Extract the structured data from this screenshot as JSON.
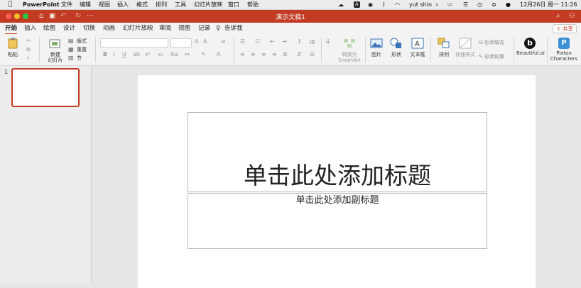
{
  "menubar": {
    "apple_icon": "",
    "app_name": "PowerPoint",
    "items": [
      "文件",
      "编辑",
      "视图",
      "插入",
      "格式",
      "排列",
      "工具",
      "幻灯片放映",
      "窗口",
      "帮助"
    ],
    "user": "yut shin",
    "datetime": "12月26日 周一 11:26",
    "status_icons": [
      "cloud-icon",
      "a-icon",
      "bluetooth-icon",
      "audio-icon",
      "wifi-icon",
      "search-icon",
      "battery-icon",
      "control-center-icon",
      "siri-icon"
    ]
  },
  "titlebar": {
    "title": "演示文稿1",
    "buttons": [
      "home-icon",
      "save-icon",
      "undo-icon",
      "redo-icon",
      "more-icon"
    ],
    "right_icons": [
      "search-icon",
      "share-person-icon"
    ]
  },
  "tabs": [
    "开始",
    "插入",
    "绘图",
    "设计",
    "切换",
    "动画",
    "幻灯片放映",
    "审阅",
    "视图",
    "记录",
    "告诉我"
  ],
  "share_label": "共享",
  "ribbon": {
    "paste": "粘贴",
    "new_slide": "新建\n幻灯片",
    "layout": "版式",
    "reset": "重置",
    "section": "节",
    "convert_smartart": "转换为\nSmartArt",
    "picture": "图片",
    "shapes": "形状",
    "textbox": "文本框",
    "arrange": "排列",
    "quick_styles": "快速样式",
    "shape_fill": "形状填充",
    "shape_outline": "形状轮廓",
    "beautiful_ai": "Beautiful.ai",
    "pixton": "Pixton\nCharacters"
  },
  "slides_pane": {
    "slide_number": "1"
  },
  "slide": {
    "title_placeholder": "单击此处添加标题",
    "subtitle_placeholder": "单击此处添加副标题"
  },
  "colors": {
    "accent": "#c23b22",
    "title_bar": "#c23b22"
  }
}
